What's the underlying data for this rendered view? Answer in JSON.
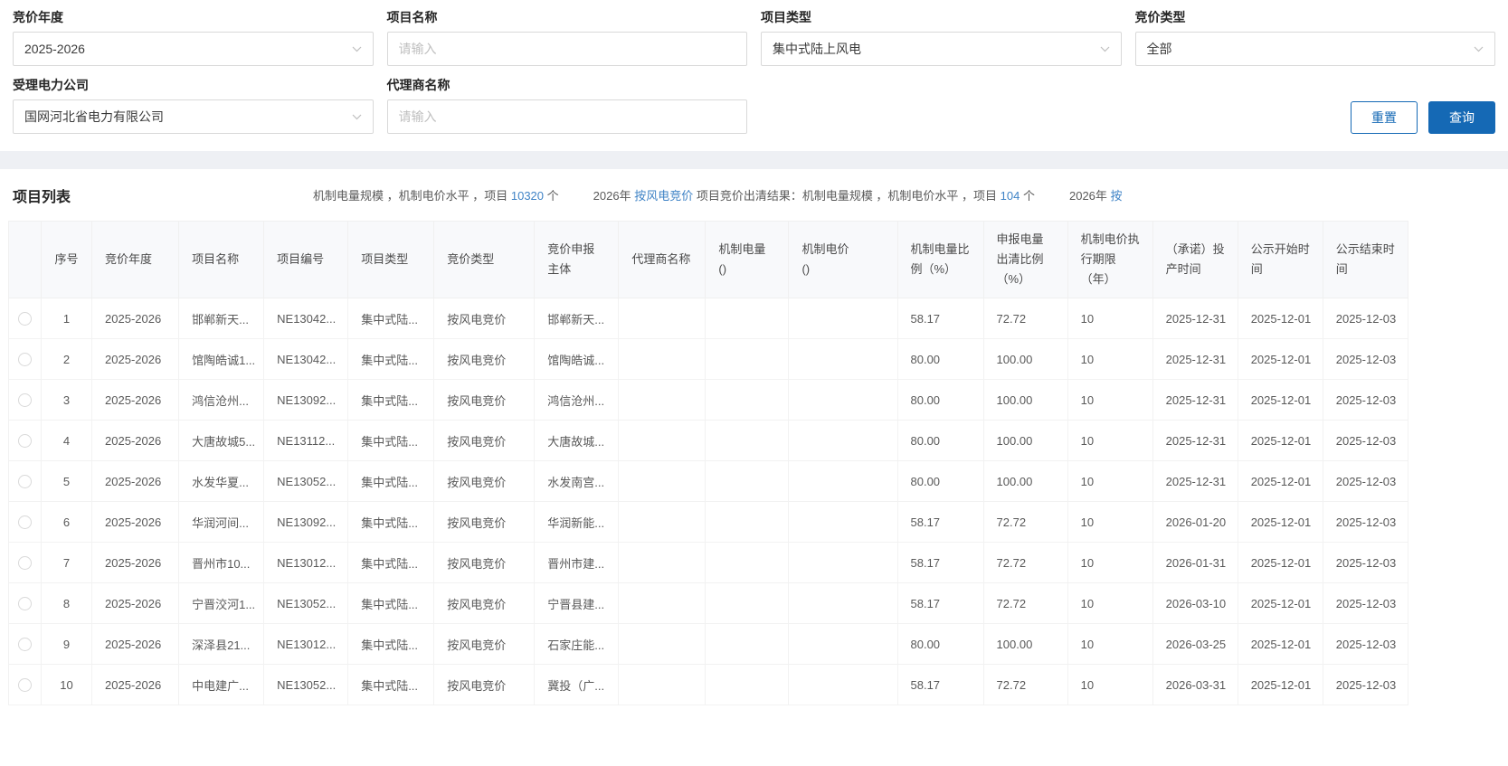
{
  "filters": {
    "fields": [
      {
        "label": "竞价年度",
        "type": "select",
        "value": "2025-2026"
      },
      {
        "label": "项目名称",
        "type": "input",
        "placeholder": "请输入"
      },
      {
        "label": "项目类型",
        "type": "select",
        "value": "集中式陆上风电"
      },
      {
        "label": "竞价类型",
        "type": "select",
        "value": "全部"
      },
      {
        "label": "受理电力公司",
        "type": "select",
        "value": "国网河北省电力有限公司"
      },
      {
        "label": "代理商名称",
        "type": "input",
        "placeholder": "请输入"
      }
    ],
    "reset_label": "重置",
    "query_label": "查询"
  },
  "list": {
    "title": "项目列表",
    "stats": {
      "seg1_pre": "机制电量规模 ，机制电价水平 ，项目 ",
      "seg1_count": "10320",
      "seg1_post": " 个",
      "seg2_pre": "2026年 ",
      "seg2_link": "按风电竞价",
      "seg2_mid": " 项目竞价出清结果：机制电量规模 ，机制电价水平 ，项目 ",
      "seg2_count": "104",
      "seg2_post": " 个",
      "seg3_pre": "2026年 ",
      "seg3_link": "按"
    }
  },
  "table": {
    "columns": [
      "序号",
      "竞价年度",
      "项目名称",
      "项目编号",
      "项目类型",
      "竞价类型",
      "竞价申报主体",
      "代理商名称",
      "机制电量\n()",
      "机制电价\n()",
      "机制电量比例（%）",
      "申报电量出清比例（%）",
      "机制电价执行期限（年）",
      "（承诺）投产时间",
      "公示开始时间",
      "公示结束时间"
    ],
    "rows": [
      [
        "1",
        "2025-2026",
        "邯郸新天...",
        "NE13042...",
        "集中式陆...",
        "按风电竞价",
        "邯郸新天...",
        "",
        "",
        "",
        "58.17",
        "72.72",
        "10",
        "2025-12-31",
        "2025-12-01",
        "2025-12-03"
      ],
      [
        "2",
        "2025-2026",
        "馆陶皓诚1...",
        "NE13042...",
        "集中式陆...",
        "按风电竞价",
        "馆陶皓诚...",
        "",
        "",
        "",
        "80.00",
        "100.00",
        "10",
        "2025-12-31",
        "2025-12-01",
        "2025-12-03"
      ],
      [
        "3",
        "2025-2026",
        "鸿信沧州...",
        "NE13092...",
        "集中式陆...",
        "按风电竞价",
        "鸿信沧州...",
        "",
        "",
        "",
        "80.00",
        "100.00",
        "10",
        "2025-12-31",
        "2025-12-01",
        "2025-12-03"
      ],
      [
        "4",
        "2025-2026",
        "大唐故城5...",
        "NE13112...",
        "集中式陆...",
        "按风电竞价",
        "大唐故城...",
        "",
        "",
        "",
        "80.00",
        "100.00",
        "10",
        "2025-12-31",
        "2025-12-01",
        "2025-12-03"
      ],
      [
        "5",
        "2025-2026",
        "水发华夏...",
        "NE13052...",
        "集中式陆...",
        "按风电竞价",
        "水发南宫...",
        "",
        "",
        "",
        "80.00",
        "100.00",
        "10",
        "2025-12-31",
        "2025-12-01",
        "2025-12-03"
      ],
      [
        "6",
        "2025-2026",
        "华润河间...",
        "NE13092...",
        "集中式陆...",
        "按风电竞价",
        "华润新能...",
        "",
        "",
        "",
        "58.17",
        "72.72",
        "10",
        "2026-01-20",
        "2025-12-01",
        "2025-12-03"
      ],
      [
        "7",
        "2025-2026",
        "晋州市10...",
        "NE13012...",
        "集中式陆...",
        "按风电竞价",
        "晋州市建...",
        "",
        "",
        "",
        "58.17",
        "72.72",
        "10",
        "2026-01-31",
        "2025-12-01",
        "2025-12-03"
      ],
      [
        "8",
        "2025-2026",
        "宁晋洨河1...",
        "NE13052...",
        "集中式陆...",
        "按风电竞价",
        "宁晋县建...",
        "",
        "",
        "",
        "58.17",
        "72.72",
        "10",
        "2026-03-10",
        "2025-12-01",
        "2025-12-03"
      ],
      [
        "9",
        "2025-2026",
        "深泽县21...",
        "NE13012...",
        "集中式陆...",
        "按风电竞价",
        "石家庄能...",
        "",
        "",
        "",
        "80.00",
        "100.00",
        "10",
        "2026-03-25",
        "2025-12-01",
        "2025-12-03"
      ],
      [
        "10",
        "2025-2026",
        "中电建广...",
        "NE13052...",
        "集中式陆...",
        "按风电竞价",
        "冀投（广...",
        "",
        "",
        "",
        "58.17",
        "72.72",
        "10",
        "2026-03-31",
        "2025-12-01",
        "2025-12-03"
      ]
    ]
  },
  "colors": {
    "primary": "#1569b5",
    "link": "#3f83c6"
  }
}
